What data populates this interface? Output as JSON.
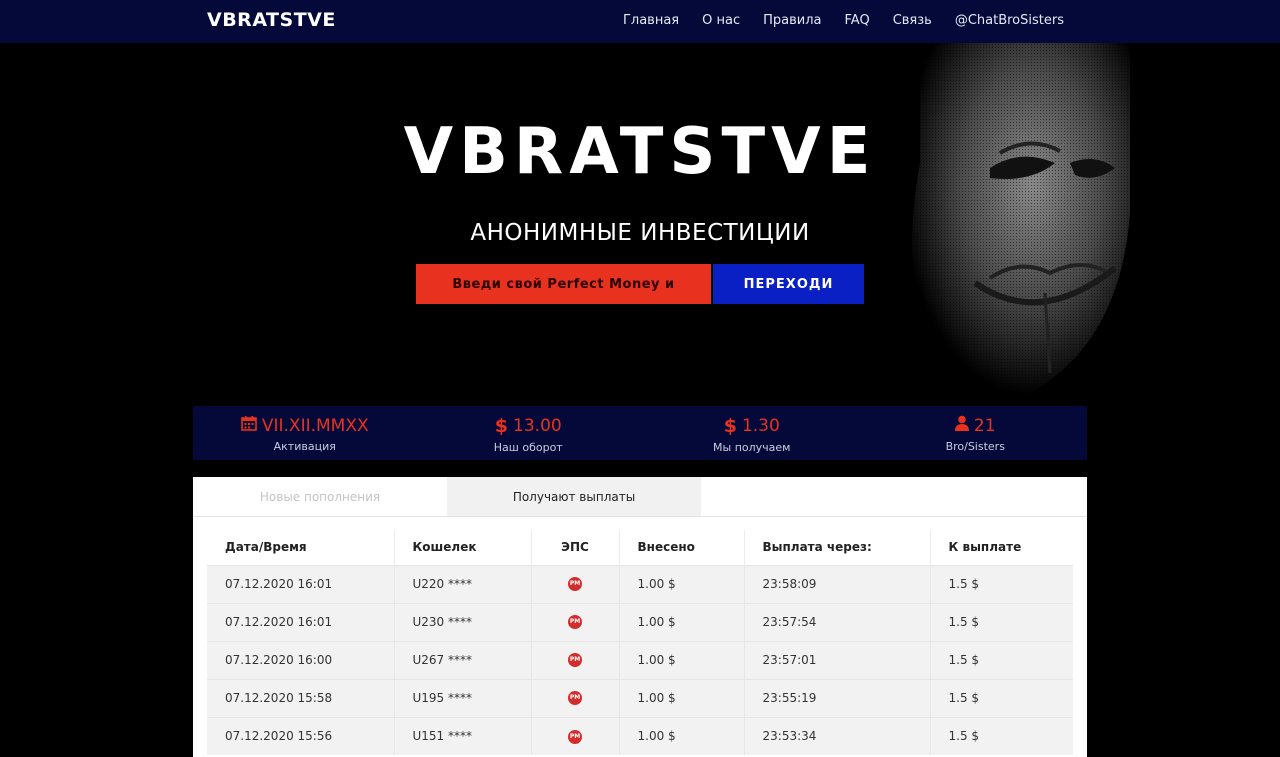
{
  "nav": {
    "brand": "VBRATSTVE",
    "links": [
      "Главная",
      "О нас",
      "Правила",
      "FAQ",
      "Связь",
      "@ChatBroSisters"
    ]
  },
  "hero": {
    "title": "VBRATSTVE",
    "subtitle": "АНОНИМНЫЕ ИНВЕСТИЦИИ",
    "input_placeholder": "Введи свой Perfect Money и",
    "button_label": "ПЕРЕХОДИ"
  },
  "stats": [
    {
      "icon": "calendar-icon",
      "value": "VII.XII.MMXX",
      "label": "Активация"
    },
    {
      "icon": "dollar-icon",
      "value": "13.00",
      "label": "Наш оборот"
    },
    {
      "icon": "dollar-icon",
      "value": "1.30",
      "label": "Мы получаем"
    },
    {
      "icon": "user-icon",
      "value": "21",
      "label": "Bro/Sisters"
    }
  ],
  "stat_symbols": {
    "dollar": "$"
  },
  "tabs": [
    "Новые пополнения",
    "Получают выплаты"
  ],
  "table": {
    "headers": [
      "Дата/Время",
      "Кошелек",
      "ЭПС",
      "Внесено",
      "Выплата через:",
      "К выплате"
    ],
    "eps_badge": "PM",
    "rows": [
      [
        "07.12.2020 16:01",
        "U220 ****",
        "1.00 $",
        "23:58:09",
        "1.5 $"
      ],
      [
        "07.12.2020 16:01",
        "U230 ****",
        "1.00 $",
        "23:57:54",
        "1.5 $"
      ],
      [
        "07.12.2020 16:00",
        "U267 ****",
        "1.00 $",
        "23:57:01",
        "1.5 $"
      ],
      [
        "07.12.2020 15:58",
        "U195 ****",
        "1.00 $",
        "23:55:19",
        "1.5 $"
      ],
      [
        "07.12.2020 15:56",
        "U151 ****",
        "1.00 $",
        "23:53:34",
        "1.5 $"
      ]
    ]
  },
  "colors": {
    "nav_bg": "#04093a",
    "accent_red": "#e8311f",
    "accent_blue": "#0a1fc4"
  }
}
